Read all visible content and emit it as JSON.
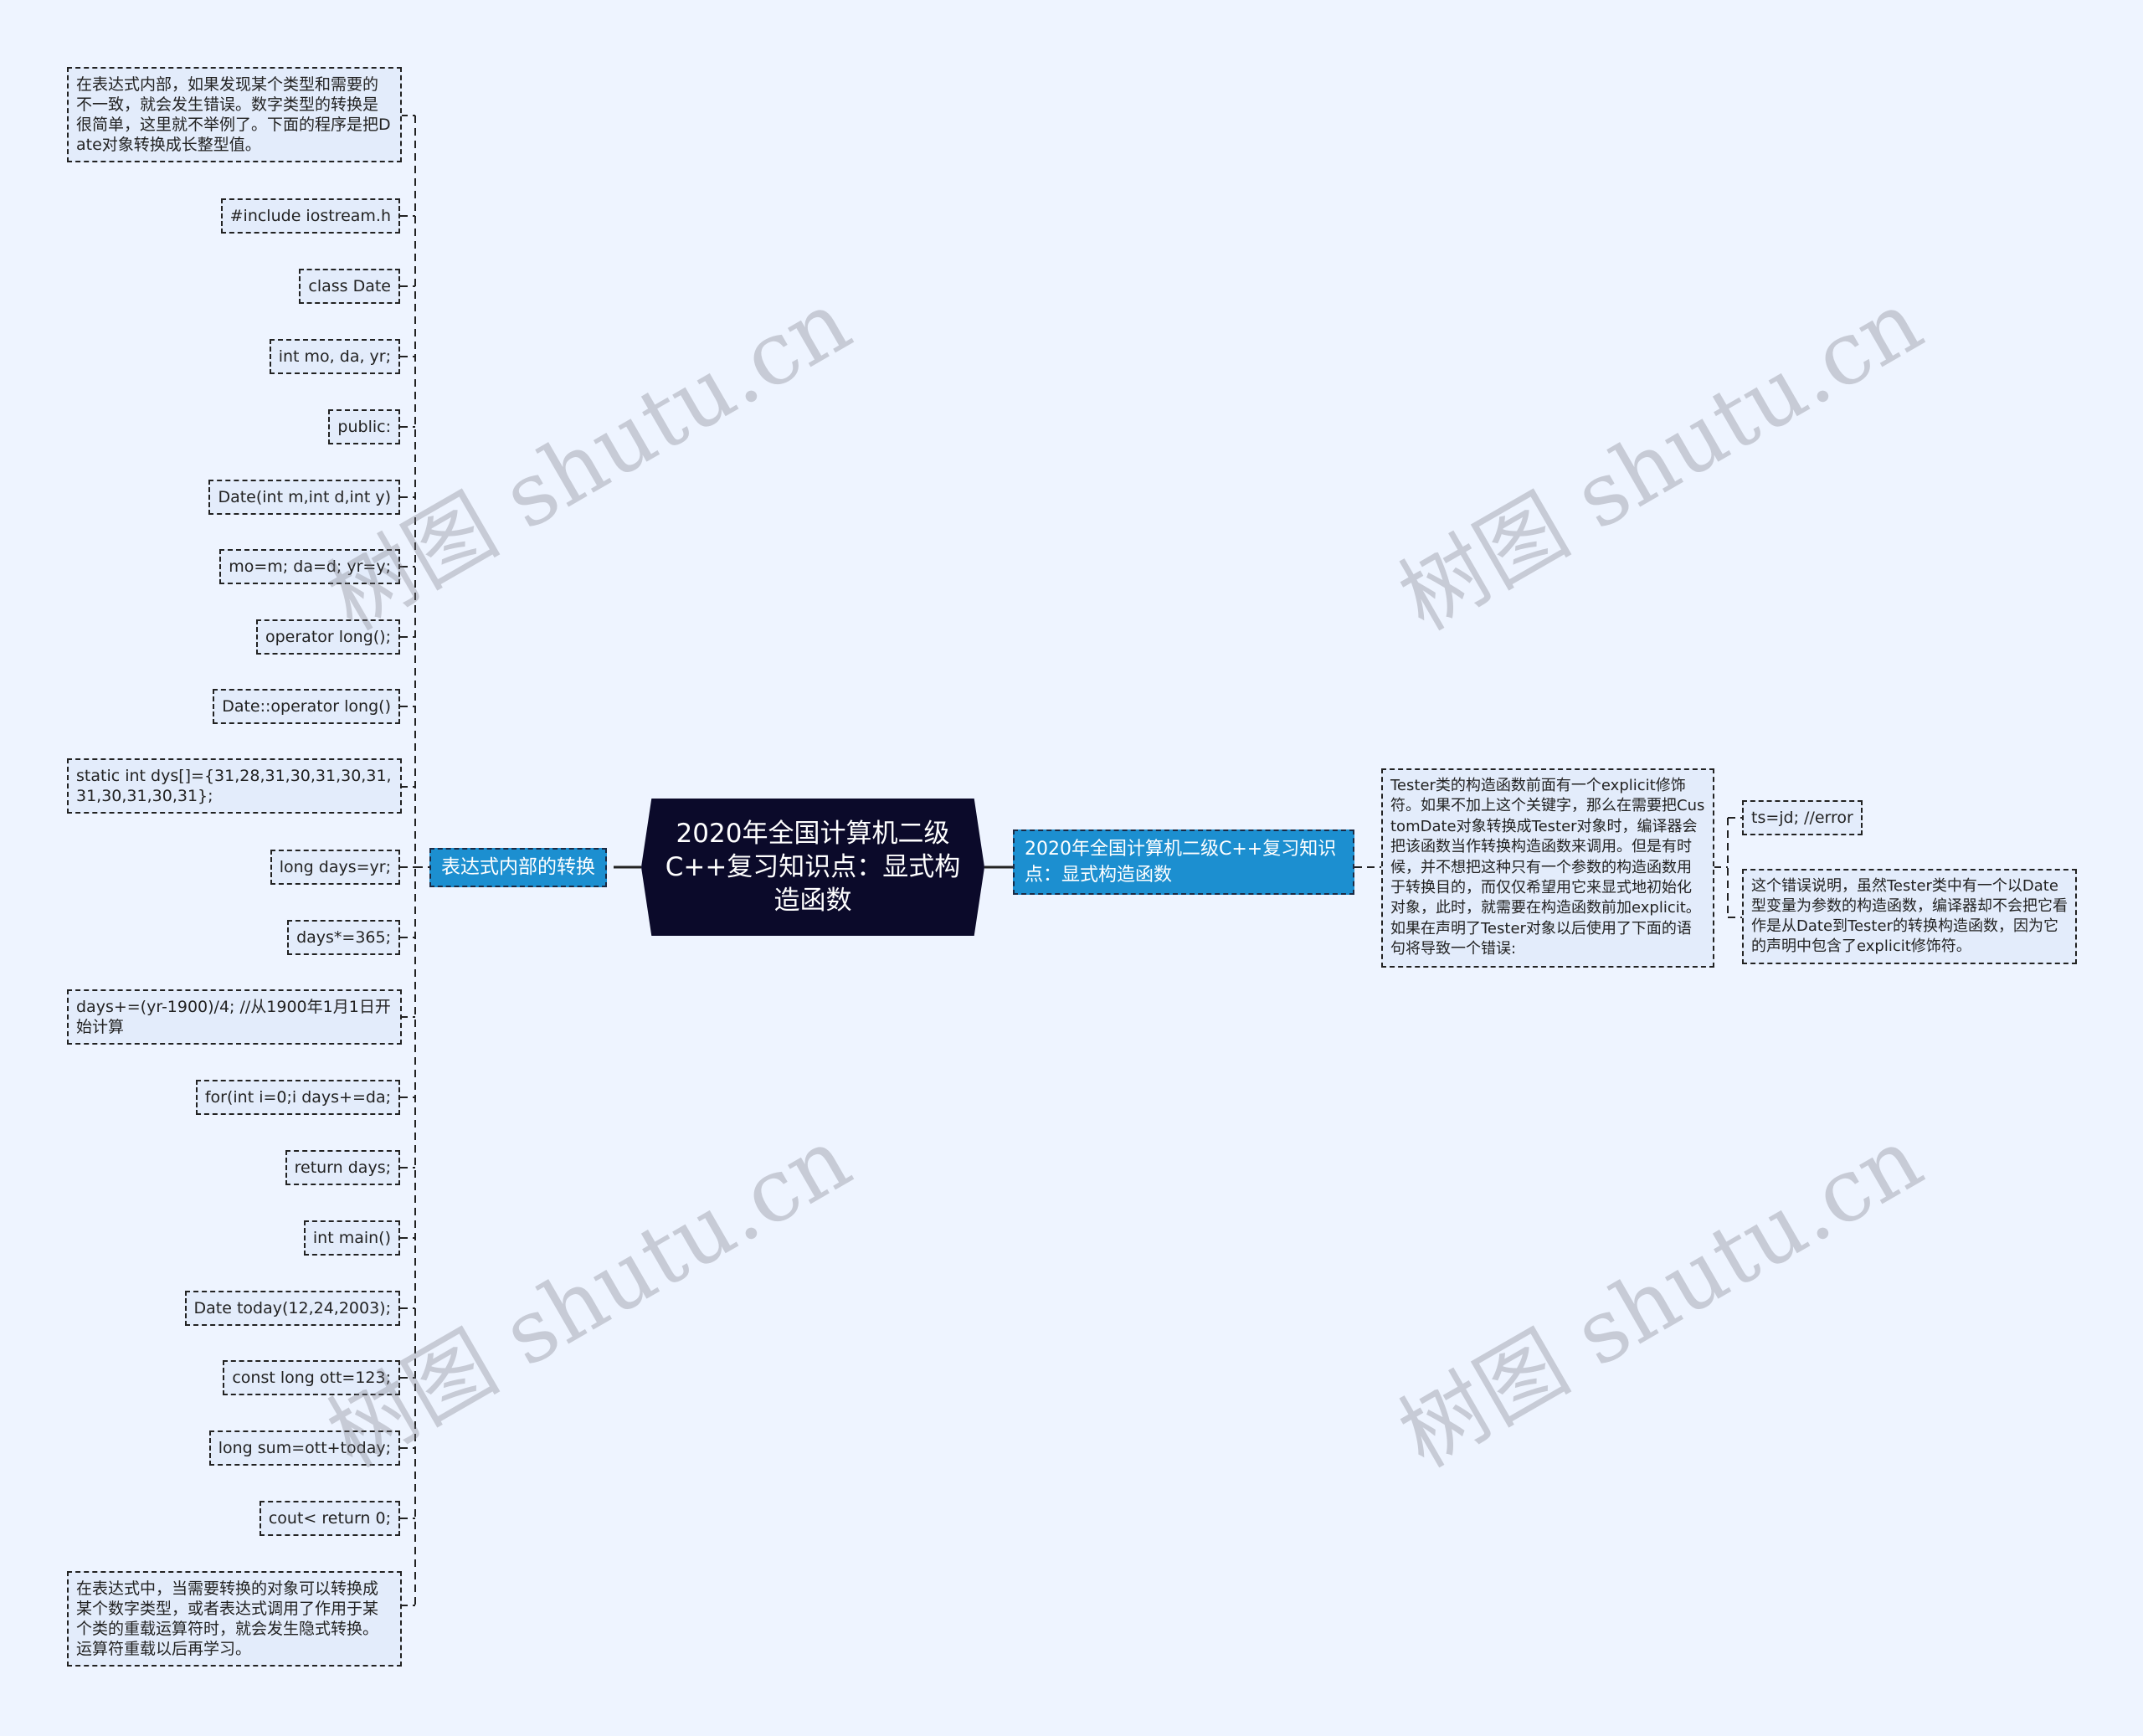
{
  "root": {
    "title": "2020年全国计算机二级C++复习知识点：显式构造函数"
  },
  "left_branch": {
    "label": "表达式内部的转换",
    "children": [
      "在表达式内部，如果发现某个类型和需要的不一致，就会发生错误。数字类型的转换是很简单，这里就不举例了。下面的程序是把Date对象转换成长整型值。",
      "#include iostream.h",
      "class Date",
      "int mo, da, yr;",
      "public:",
      "Date(int m,int d,int y)",
      "mo=m; da=d; yr=y;",
      "operator long();",
      "Date::operator long()",
      "static int dys[]={31,28,31,30,31,30,31,31,30,31,30,31};",
      "long days=yr;",
      "days*=365;",
      "days+=(yr-1900)/4; //从1900年1月1日开始计算",
      "for(int i=0;i days+=da;",
      "return days;",
      "int main()",
      "Date today(12,24,2003);",
      "const long ott=123;",
      "long sum=ott+today;",
      "cout< return 0;",
      "在表达式中，当需要转换的对象可以转换成某个数字类型，或者表达式调用了作用于某个类的重载运算符时，就会发生隐式转换。运算符重载以后再学习。"
    ]
  },
  "right_branch": {
    "label": "2020年全国计算机二级C++复习知识点：显式构造函数",
    "child": {
      "text": "Tester类的构造函数前面有一个explicit修饰符。如果不加上这个关键字，那么在需要把CustomDate对象转换成Tester对象时，编译器会把该函数当作转换构造函数来调用。但是有时候，并不想把这种只有一个参数的构造函数用于转换目的，而仅仅希望用它来显式地初始化对象，此时，就需要在构造函数前加explicit。如果在声明了Tester对象以后使用了下面的语句将导致一个错误:",
      "children": [
        "ts=jd; //error",
        "这个错误说明，虽然Tester类中有一个以Date型变量为参数的构造函数，编译器却不会把它看作是从Date到Tester的转换构造函数，因为它的声明中包含了explicit修饰符。"
      ]
    }
  },
  "watermark": "树图 shutu.cn"
}
